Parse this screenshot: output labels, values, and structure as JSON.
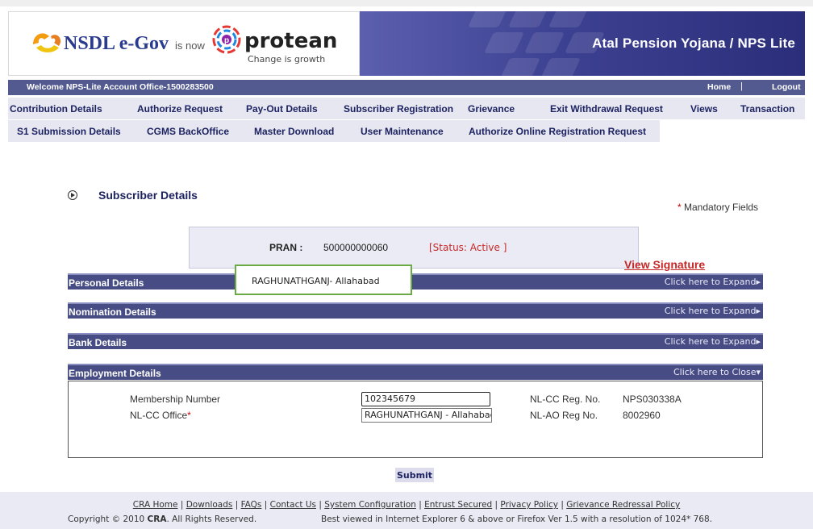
{
  "header": {
    "nsdl_logo_text": "NSDL e-Gov",
    "is_now_text": "is now",
    "protean_logo_text": "protean",
    "protean_tagline": "Change is growth",
    "banner_title": "Atal Pension Yojana / NPS Lite"
  },
  "navbar": {
    "welcome": "Welcome NPS-Lite Account Office-1500283500",
    "home": "Home",
    "separator": "|",
    "logout": "Logout",
    "menu_row1": [
      "Contribution Details",
      "Authorize Request",
      "Pay-Out Details",
      "Subscriber Registration",
      "Grievance",
      "Exit Withdrawal Request",
      "Views",
      "Transaction"
    ],
    "menu_row2": [
      "S1 Submission Details",
      "CGMS BackOffice",
      "Master Download",
      "User Maintenance",
      "Authorize Online Registration Request"
    ]
  },
  "page": {
    "title": "Subscriber Details",
    "mandatory_star": "*",
    "mandatory_text": "Mandatory Fields",
    "pran_label": "PRAN :",
    "pran_value": "500000000060",
    "status": "[Status: Active ]",
    "view_signature": "View Signature",
    "tooltip": "RAGHUNATHGANJ- Allahabad"
  },
  "sections": {
    "personal": {
      "label": "Personal Details",
      "action": "Click here to Expand▸"
    },
    "nomination": {
      "label": "Nomination Details",
      "action": "Click here to Expand▸"
    },
    "bank": {
      "label": "Bank Details",
      "action": "Click here to Expand▸"
    },
    "employment": {
      "label": "Employment Details",
      "action": "Click here to Close▾"
    }
  },
  "employment": {
    "membership_label": "Membership Number",
    "membership_value": "102345679",
    "nlcc_office_label": "NL-CC Office",
    "nlcc_office_value": "RAGHUNATHGANJ - Allahabad",
    "nlcc_reg_label": "NL-CC Reg. No.",
    "nlcc_reg_value": "NPS030338A",
    "nlao_reg_label": "NL-AO Reg No.",
    "nlao_reg_value": "8002960"
  },
  "submit": "Submit",
  "footer": {
    "links": [
      "CRA Home",
      "Downloads",
      "FAQs",
      "Contact Us",
      "System Configuration",
      "Entrust Secured",
      "Privacy Policy",
      "Grievance Redressal Policy"
    ],
    "copyright_prefix": "Copyright © 2010",
    "copyright_brand": "CRA",
    "copyright_suffix": ". All Rights Reserved.",
    "best_viewed": "Best viewed in Internet Explorer 6 & above or Firefox Ver 1.5 with a resolution of 1024* 768."
  }
}
